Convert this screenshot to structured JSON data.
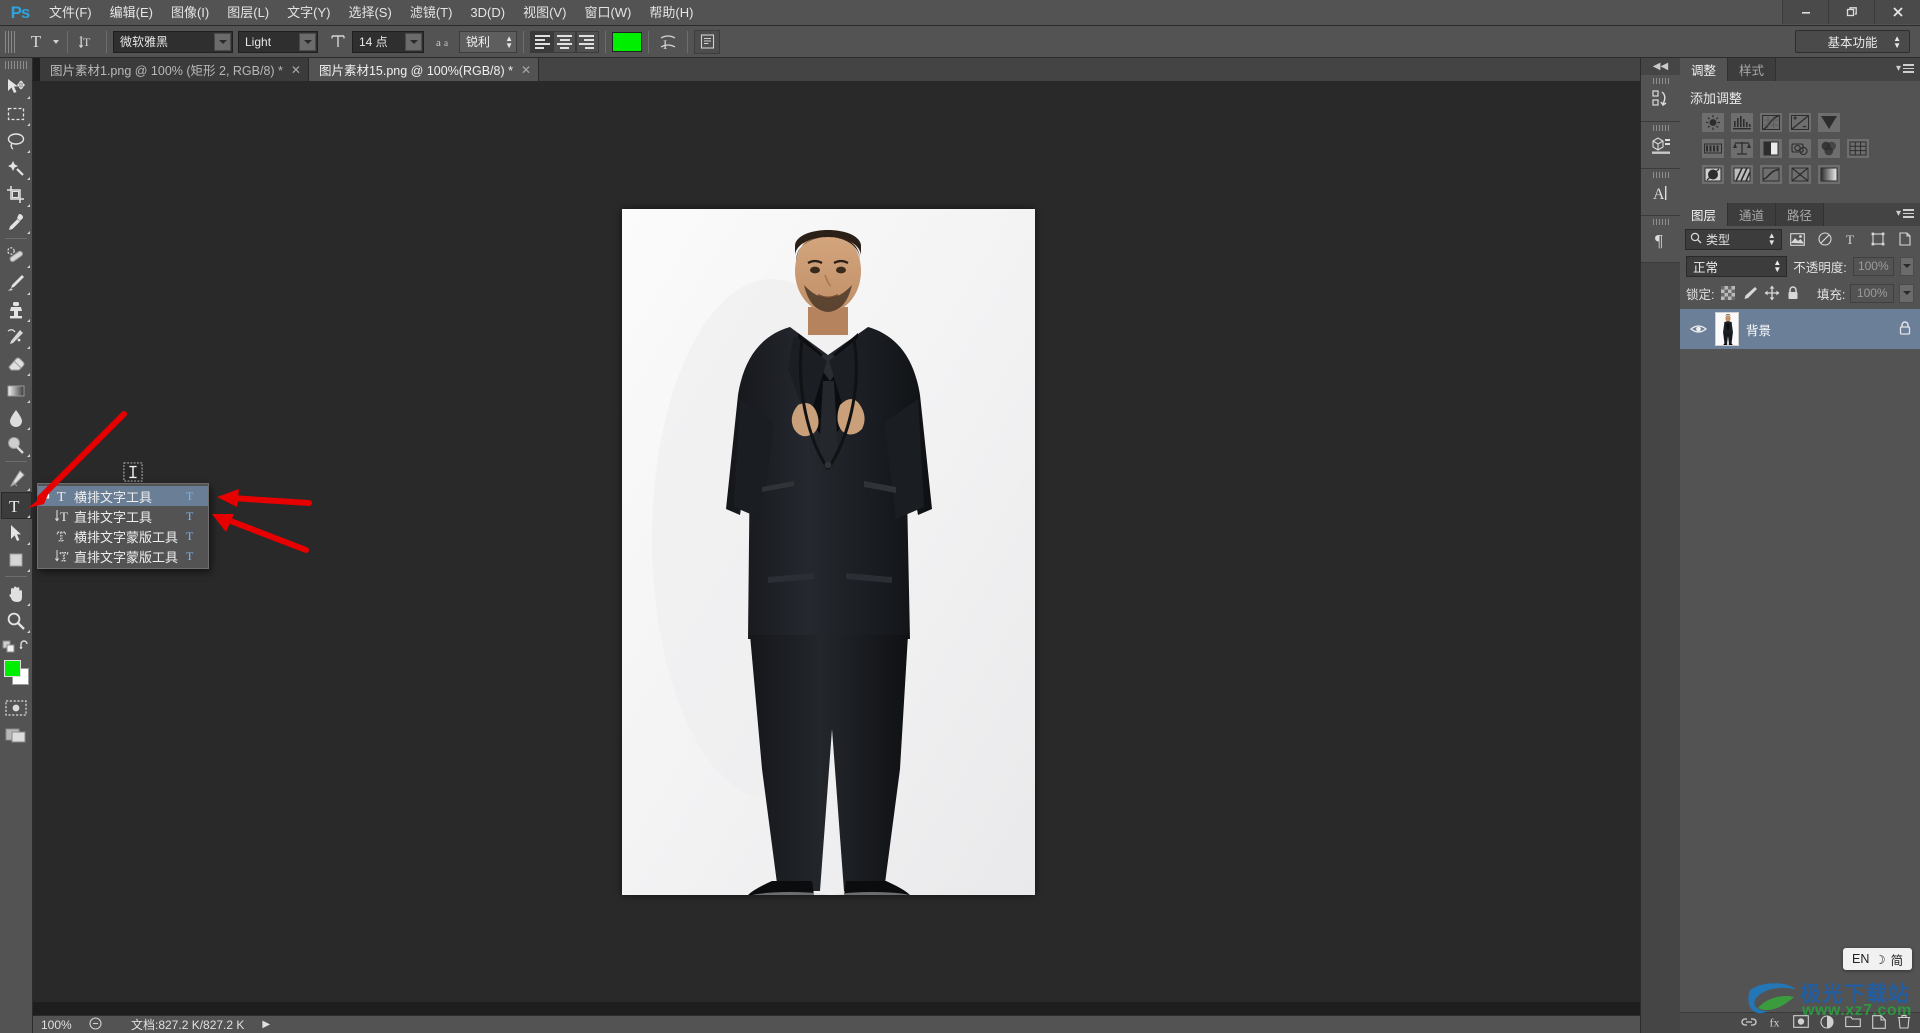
{
  "app": {
    "name": "Ps",
    "logo": "Ps"
  },
  "menubar": {
    "items": [
      {
        "label": "文件(F)"
      },
      {
        "label": "编辑(E)"
      },
      {
        "label": "图像(I)"
      },
      {
        "label": "图层(L)"
      },
      {
        "label": "文字(Y)"
      },
      {
        "label": "选择(S)"
      },
      {
        "label": "滤镜(T)"
      },
      {
        "label": "3D(D)"
      },
      {
        "label": "视图(V)"
      },
      {
        "label": "窗口(W)"
      },
      {
        "label": "帮助(H)"
      }
    ],
    "window_controls": {
      "minimize": "—",
      "restore": "❐",
      "close": "✕"
    }
  },
  "options_bar": {
    "tool_preset_label": "T",
    "orientation_icon": "text-orientation-icon",
    "font_family": "微软雅黑",
    "font_style": "Light",
    "size_icon": "font-size-icon",
    "font_size": "14 点",
    "antialias_icon": "aa",
    "antialias": "锐利",
    "align_left": "align-left",
    "align_center": "align-center",
    "align_right": "align-right",
    "color_swatch": "#00ef00",
    "warp_icon": "warp-text-icon",
    "panels_icon": "character-panel-icon",
    "workspace": "基本功能"
  },
  "tabs": [
    {
      "label": "图片素材1.png @ 100% (矩形 2, RGB/8) *",
      "active": false,
      "close": "✕"
    },
    {
      "label": "图片素材15.png @ 100%(RGB/8) *",
      "active": true,
      "close": "✕"
    }
  ],
  "toolbar": {
    "tools": [
      {
        "name": "move-tool",
        "glyph": "move",
        "sub": true,
        "selected": false
      },
      {
        "name": "rectangular-marquee-tool",
        "glyph": "marquee",
        "sub": true,
        "selected": false
      },
      {
        "name": "lasso-tool",
        "glyph": "lasso",
        "sub": true,
        "selected": false
      },
      {
        "name": "magic-wand-tool",
        "glyph": "wand",
        "sub": true,
        "selected": false
      },
      {
        "name": "crop-tool",
        "glyph": "crop",
        "sub": true,
        "selected": false
      },
      {
        "name": "eyedropper-tool",
        "glyph": "eyedropper",
        "sub": true,
        "selected": false
      },
      {
        "name": "spot-healing-brush-tool",
        "glyph": "heal",
        "sub": true,
        "selected": false
      },
      {
        "name": "brush-tool",
        "glyph": "brush",
        "sub": true,
        "selected": false
      },
      {
        "name": "clone-stamp-tool",
        "glyph": "stamp",
        "sub": true,
        "selected": false
      },
      {
        "name": "history-brush-tool",
        "glyph": "historybrush",
        "sub": true,
        "selected": false
      },
      {
        "name": "eraser-tool",
        "glyph": "eraser",
        "sub": true,
        "selected": false
      },
      {
        "name": "gradient-tool",
        "glyph": "gradient",
        "sub": true,
        "selected": false
      },
      {
        "name": "blur-tool",
        "glyph": "blur",
        "sub": true,
        "selected": false
      },
      {
        "name": "dodge-tool",
        "glyph": "dodge",
        "sub": true,
        "selected": false
      },
      {
        "name": "pen-tool",
        "glyph": "pen",
        "sub": true,
        "selected": false
      },
      {
        "name": "horizontal-type-tool",
        "glyph": "type",
        "sub": true,
        "selected": true
      },
      {
        "name": "path-selection-tool",
        "glyph": "pathselect",
        "sub": true,
        "selected": false
      },
      {
        "name": "rectangle-tool",
        "glyph": "rect",
        "sub": true,
        "selected": false
      },
      {
        "name": "hand-tool",
        "glyph": "hand",
        "sub": true,
        "selected": false
      },
      {
        "name": "zoom-tool",
        "glyph": "zoom",
        "sub": true,
        "selected": false
      }
    ],
    "foreground_color": "#00ef00",
    "background_color": "#ffffff",
    "swap_icon": "swap-colors-icon",
    "default_colors_icon": "default-colors-icon",
    "quick_mask_icon": "quick-mask-icon",
    "screen_mode_icon": "screen-mode-icon"
  },
  "type_flyout": {
    "items": [
      {
        "label": "横排文字工具",
        "shortcut": "T",
        "icon": "horizontal-type-icon",
        "selected": true
      },
      {
        "label": "直排文字工具",
        "shortcut": "T",
        "icon": "vertical-type-icon",
        "selected": false
      },
      {
        "label": "横排文字蒙版工具",
        "shortcut": "T",
        "icon": "horizontal-type-mask-icon",
        "selected": false
      },
      {
        "label": "直排文字蒙版工具",
        "shortcut": "T",
        "icon": "vertical-type-mask-icon",
        "selected": false
      }
    ]
  },
  "status_bar": {
    "zoom": "100%",
    "doc_info": "文档:827.2 K/827.2 K"
  },
  "dock_strip": {
    "collapse_icon": "collapse-panels-icon",
    "cells": [
      {
        "name": "history-panel-icon",
        "glyph": "history"
      },
      {
        "name": "3d-panel-icon",
        "glyph": "cube"
      },
      {
        "name": "character-panel-icon",
        "glyph": "A"
      },
      {
        "name": "paragraph-panel-icon",
        "glyph": "¶"
      }
    ]
  },
  "adjustments_panel": {
    "tabs": [
      {
        "label": "调整",
        "active": true
      },
      {
        "label": "样式",
        "active": false
      }
    ],
    "title": "添加调整",
    "rows": [
      [
        "brightness-contrast-icon",
        "levels-icon",
        "curves-icon",
        "exposure-icon",
        "vibrance-icon"
      ],
      [
        "hue-saturation-icon",
        "color-balance-icon",
        "black-white-icon",
        "photo-filter-icon",
        "channel-mixer-icon",
        "color-lookup-icon"
      ],
      [
        "invert-icon",
        "posterize-icon",
        "threshold-icon",
        "selective-color-icon",
        "gradient-map-icon"
      ]
    ]
  },
  "layers_panel": {
    "tabs": [
      {
        "label": "图层",
        "active": true
      },
      {
        "label": "通道",
        "active": false
      },
      {
        "label": "路径",
        "active": false
      }
    ],
    "filter_label": "类型",
    "filter_icons": [
      "pixel-filter-icon",
      "adjustment-filter-icon",
      "type-filter-icon",
      "shape-filter-icon",
      "smartobject-filter-icon"
    ],
    "blend_mode": "正常",
    "opacity_label": "不透明度:",
    "opacity_value": "100%",
    "lock_label": "锁定:",
    "lock_icons": [
      "lock-transparent-icon",
      "lock-image-icon",
      "lock-position-icon",
      "lock-all-icon"
    ],
    "fill_label": "填充:",
    "fill_value": "100%",
    "layers": [
      {
        "name": "背景",
        "visible": true,
        "locked": true,
        "thumb": "man-in-suit-thumbnail"
      }
    ],
    "bottom_icons": [
      "link-layers-icon",
      "layer-style-icon",
      "layer-mask-icon",
      "adjustment-layer-icon",
      "new-group-icon",
      "new-layer-icon",
      "delete-layer-icon"
    ]
  },
  "ime": {
    "lang": "EN",
    "mode_icon": "☽",
    "script": "简"
  },
  "watermark": {
    "title": "极光下载站",
    "url": "www.xz7.com"
  },
  "annotations": {
    "arrows": [
      {
        "name": "arrow-to-type-tool"
      },
      {
        "name": "arrow-to-horizontal-type-tool"
      },
      {
        "name": "arrow-to-vertical-type-tool"
      }
    ]
  },
  "canvas": {
    "document_title": "图片素材15.png",
    "zoom": "100%"
  }
}
